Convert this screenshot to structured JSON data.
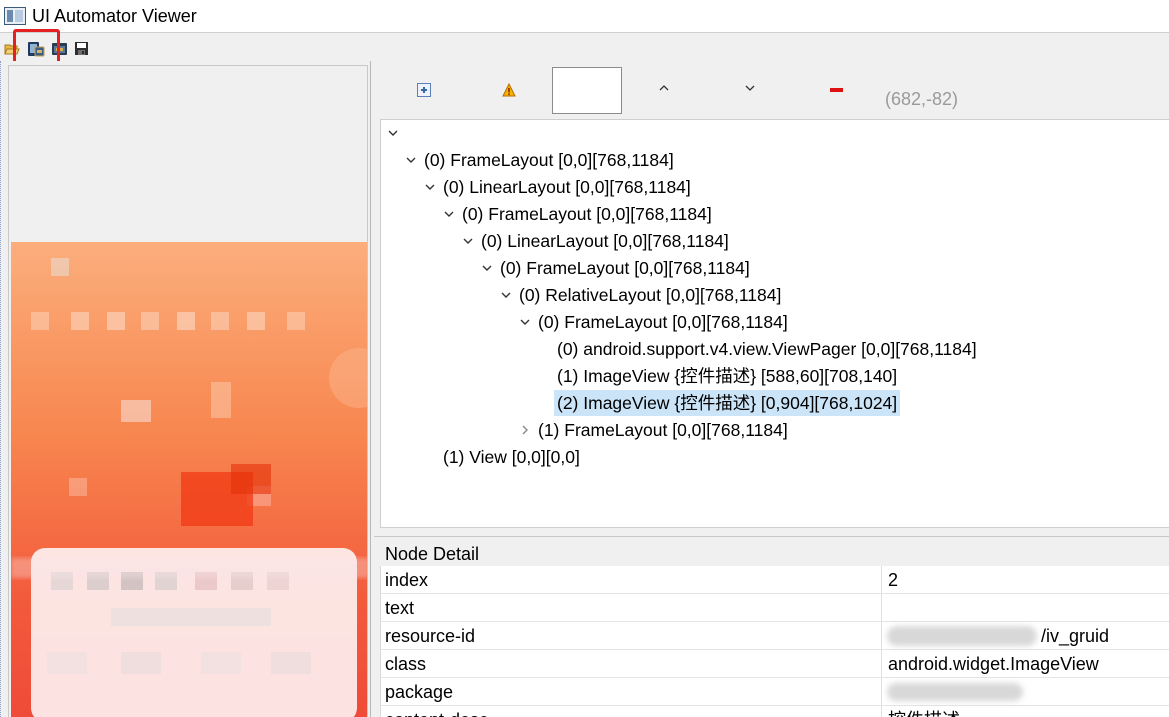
{
  "window": {
    "title": "UI Automator Viewer",
    "icon": "window-app-icon"
  },
  "toolbar": {
    "icons": [
      "folder-open-icon",
      "device-screenshot-icon",
      "device-screenshot-compressed-icon",
      "save-icon"
    ]
  },
  "tree_toolbar": {
    "icons": [
      "expand-all-icon",
      "toggle-nav-warning-icon",
      "search-field",
      "previous-arrow-icon",
      "next-arrow-icon",
      "clear-highlight-icon"
    ],
    "up_glyph": "^",
    "down_glyph": "v",
    "coordinates": "(682,-82)"
  },
  "tree": {
    "root_glyph": "v",
    "nodes": [
      {
        "label": "(0) FrameLayout [0,0][768,1184]",
        "expanded": true
      },
      {
        "label": "(0) LinearLayout [0,0][768,1184]",
        "expanded": true
      },
      {
        "label": "(0) FrameLayout [0,0][768,1184]",
        "expanded": true
      },
      {
        "label": "(0) LinearLayout [0,0][768,1184]",
        "expanded": true
      },
      {
        "label": "(0) FrameLayout [0,0][768,1184]",
        "expanded": true
      },
      {
        "label": "(0) RelativeLayout [0,0][768,1184]",
        "expanded": true
      },
      {
        "label": "(0) FrameLayout [0,0][768,1184]",
        "expanded": true
      },
      {
        "label": "(0) android.support.v4.view.ViewPager [0,0][768,1184]",
        "expanded": null
      },
      {
        "label": "(1) ImageView {控件描述} [588,60][708,140]",
        "expanded": null
      },
      {
        "label": "(2) ImageView {控件描述} [0,904][768,1024]",
        "expanded": null,
        "selected": true
      },
      {
        "label": "(1) FrameLayout [0,0][768,1184]",
        "expanded": false
      },
      {
        "label": "(1) View [0,0][0,0]",
        "expanded": null
      }
    ]
  },
  "node_detail": {
    "title": "Node Detail",
    "rows": [
      {
        "key": "index",
        "value": "2"
      },
      {
        "key": "text",
        "value": ""
      },
      {
        "key": "resource-id",
        "value": "/iv_gruid"
      },
      {
        "key": "class",
        "value": "android.widget.ImageView"
      },
      {
        "key": "package",
        "value": ""
      },
      {
        "key": "content-desc",
        "value": "控件描述"
      }
    ]
  },
  "colors": {
    "selection": "#cce4f7",
    "highlight_box": "#e52020",
    "coords_text": "#9a9a9a",
    "device_orange": "#f98a5a",
    "device_red": "#f03c1e"
  }
}
